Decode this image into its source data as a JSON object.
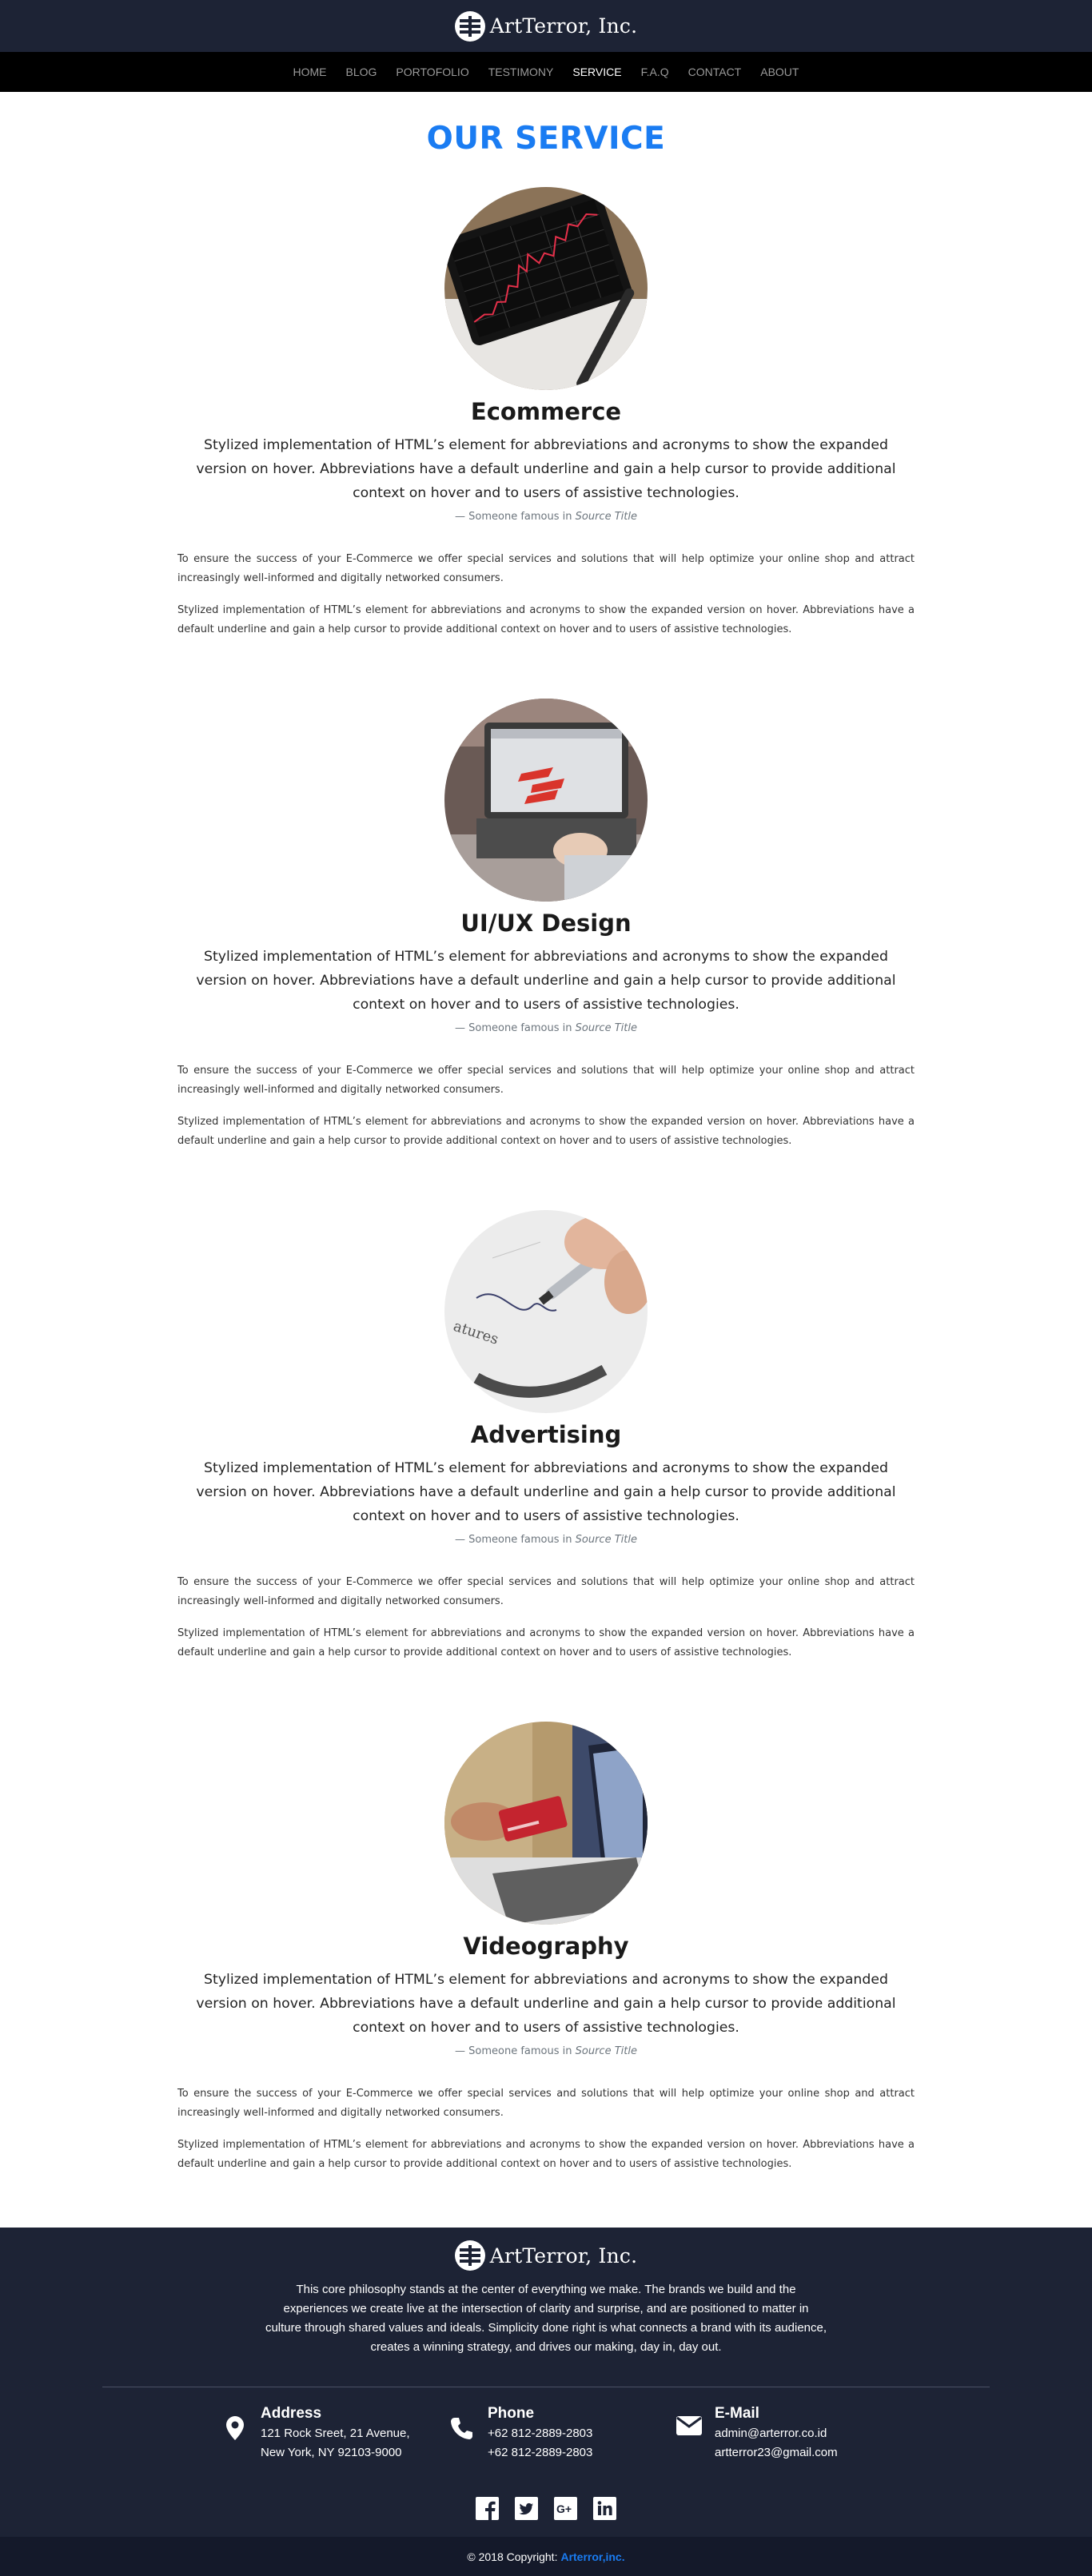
{
  "brand": {
    "name": "ArtTerror, Inc."
  },
  "nav": {
    "items": [
      {
        "label": "HOME"
      },
      {
        "label": "BLOG"
      },
      {
        "label": "PORTOFOLIO"
      },
      {
        "label": "TESTIMONY"
      },
      {
        "label": "SERVICE"
      },
      {
        "label": "F.A.Q"
      },
      {
        "label": "CONTACT"
      },
      {
        "label": "ABOUT"
      }
    ],
    "active": "SERVICE"
  },
  "page": {
    "title": "OUR SERVICE"
  },
  "services": [
    {
      "title": "Ecommerce",
      "image": "stock-chart-tablet",
      "lead": "Stylized implementation of HTML’s element for abbreviations and acronyms to show the expanded version on hover. Abbreviations have a default underline and gain a help cursor to provide additional context on hover and to users of assistive technologies.",
      "quote_prefix": "— Someone famous in ",
      "quote_source": "Source Title",
      "para1": "To ensure the success of your E-Commerce we offer special services and solutions that will help optimize your online shop and attract increasingly well-informed and digitally networked consumers.",
      "para2": "Stylized implementation of HTML’s element for abbreviations and acronyms to show the expanded version on hover. Abbreviations have a default underline and gain a help cursor to provide additional context on hover and to users of assistive technologies."
    },
    {
      "title": "UI/UX Design",
      "image": "laptop-design",
      "lead": "Stylized implementation of HTML’s element for abbreviations and acronyms to show the expanded version on hover. Abbreviations have a default underline and gain a help cursor to provide additional context on hover and to users of assistive technologies.",
      "quote_prefix": "— Someone famous in ",
      "quote_source": "Source Title",
      "para1": "To ensure the success of your E-Commerce we offer special services and solutions that will help optimize your online shop and attract increasingly well-informed and digitally networked consumers.",
      "para2": "Stylized implementation of HTML’s element for abbreviations and acronyms to show the expanded version on hover. Abbreviations have a default underline and gain a help cursor to provide additional context on hover and to users of assistive technologies."
    },
    {
      "title": "Advertising",
      "image": "pen-signing",
      "lead": "Stylized implementation of HTML’s element for abbreviations and acronyms to show the expanded version on hover. Abbreviations have a default underline and gain a help cursor to provide additional context on hover and to users of assistive technologies.",
      "quote_prefix": "— Someone famous in ",
      "quote_source": "Source Title",
      "para1": "To ensure the success of your E-Commerce we offer special services and solutions that will help optimize your online shop and attract increasingly well-informed and digitally networked consumers.",
      "para2": "Stylized implementation of HTML’s element for abbreviations and acronyms to show the expanded version on hover. Abbreviations have a default underline and gain a help cursor to provide additional context on hover and to users of assistive technologies."
    },
    {
      "title": "Videography",
      "image": "card-laptop",
      "lead": "Stylized implementation of HTML’s element for abbreviations and acronyms to show the expanded version on hover. Abbreviations have a default underline and gain a help cursor to provide additional context on hover and to users of assistive technologies.",
      "quote_prefix": "— Someone famous in ",
      "quote_source": "Source Title",
      "para1": "To ensure the success of your E-Commerce we offer special services and solutions that will help optimize your online shop and attract increasingly well-informed and digitally networked consumers.",
      "para2": "Stylized implementation of HTML’s element for abbreviations and acronyms to show the expanded version on hover. Abbreviations have a default underline and gain a help cursor to provide additional context on hover and to users of assistive technologies."
    }
  ],
  "footer": {
    "about": "This core philosophy stands at the center of everything we make. The brands we build and the experiences we create live at the intersection of clarity and surprise, and are positioned to matter in culture through shared values and ideals. Simplicity done right is what connects a brand with its audience, creates a winning strategy, and drives our making, day in, day out.",
    "address": {
      "title": "Address",
      "line1": "121 Rock Sreet, 21 Avenue,",
      "line2": "New York, NY 92103-9000",
      "icon": "map-pin-icon"
    },
    "phone": {
      "title": "Phone",
      "line1": "+62 812-2889-2803",
      "line2": "+62 812-2889-2803",
      "icon": "phone-icon"
    },
    "email": {
      "title": "E-Mail",
      "line1": "admin@arterror.co.id",
      "line2": "artterror23@gmail.com",
      "icon": "envelope-icon"
    },
    "socials": [
      "facebook-icon",
      "twitter-icon",
      "google-plus-icon",
      "linkedin-icon"
    ],
    "copyright_prefix": "© 2018 Copyright:",
    "copyright_link": "Arterror,inc."
  },
  "colors": {
    "header_bg": "#1d2335",
    "nav_bg": "#000000",
    "accent": "#1a7cf2",
    "copy_bg": "#14192a"
  }
}
